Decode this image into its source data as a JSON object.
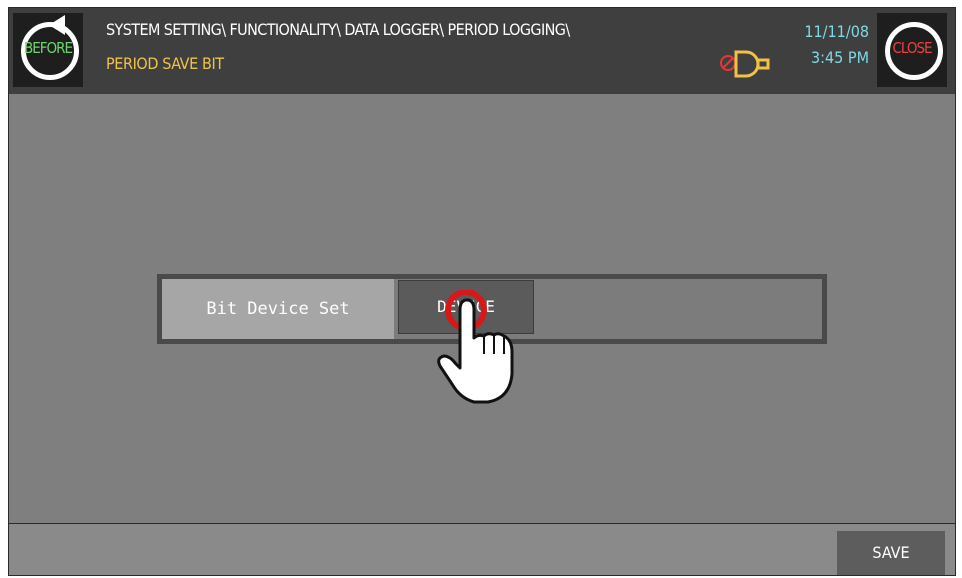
{
  "header": {
    "path": "SYSTEM SETTING\\ FUNCTIONALITY\\ DATA LOGGER\\ PERIOD LOGGING\\",
    "title": "PERIOD SAVE BIT",
    "before_label": "BEFORE",
    "close_label": "CLOSE",
    "date": "11/11/08",
    "time": "3:45 PM"
  },
  "setting": {
    "label": "Bit Device Set",
    "device_button": "DEVICE"
  },
  "footer": {
    "save_label": "SAVE"
  },
  "colors": {
    "header_bg": "#3f3f3f",
    "title_yellow": "#f0c24a",
    "clock_cyan": "#7fd9e6",
    "before_green": "#6fd46f",
    "close_red": "#ee4040"
  },
  "icons": [
    "back-arrow-icon",
    "buzzer-off-icon",
    "hand-pointer-icon"
  ]
}
